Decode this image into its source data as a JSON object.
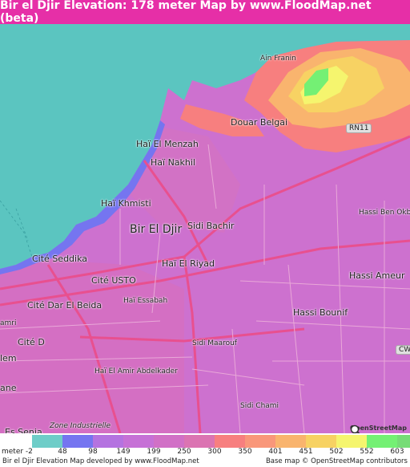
{
  "title": "Bir el Djir Elevation: 178 meter Map by www.FloodMap.net (beta)",
  "map": {
    "places": {
      "ain_franin": "Ain Franin",
      "douar_belgai": "Douar Belgai",
      "hai_el_menzah": "Haï El Menzah",
      "hai_nakhil": "Haï Nakhil",
      "hai_khmisti": "Haï Khmisti",
      "bir_el_djir": "Bir El Djir",
      "sidi_bachir": "Sidi Bachir",
      "hassi_ben_okba": "Hassi Ben Okba",
      "cite_seddika": "Cité Seddika",
      "hai_el_riyad": "Haï El Riyad",
      "hassi_ameur": "Hassi Ameur",
      "cite_usto": "Cité USTO",
      "hai_essabah": "Haï Essabah",
      "cite_dar_el_beida": "Cité Dar El Beida",
      "hassi_bounif": "Hassi Bounif",
      "amri": "amri",
      "cite_d": "Cité D",
      "sidi_maarouf": "Sidi Maarouf",
      "elem": "lem",
      "hai_el_amir_abdelkader": "Haï El Amir Abdelkader",
      "ane": "ane",
      "sidi_chami": "Sidi Chami",
      "zone_industrielle": "Zone Industrielle",
      "es_senia": "Es Senia"
    },
    "roads": {
      "rn11": "RN11",
      "cw": "CW"
    },
    "osm_logo_text": "OpenStreetMap"
  },
  "legend": {
    "unit_label": "meter",
    "labels": [
      "-2",
      "48",
      "98",
      "149",
      "199",
      "250",
      "300",
      "350",
      "401",
      "451",
      "502",
      "552",
      "603"
    ],
    "colors": [
      "#6ecdc8",
      "#7575f0",
      "#b473e0",
      "#c671d6",
      "#d170c6",
      "#db74b2",
      "#f77f7f",
      "#f9977a",
      "#f9b46e",
      "#f7d263",
      "#f5f56e",
      "#74f074",
      "#76dc76"
    ]
  },
  "footer": {
    "left": "Bir el Djir Elevation Map developed by www.FloodMap.net",
    "right": "Base map © OpenStreetMap contributors"
  },
  "colors": {
    "title_bg": "#e62fa7",
    "sea": "#5bc5c0"
  }
}
